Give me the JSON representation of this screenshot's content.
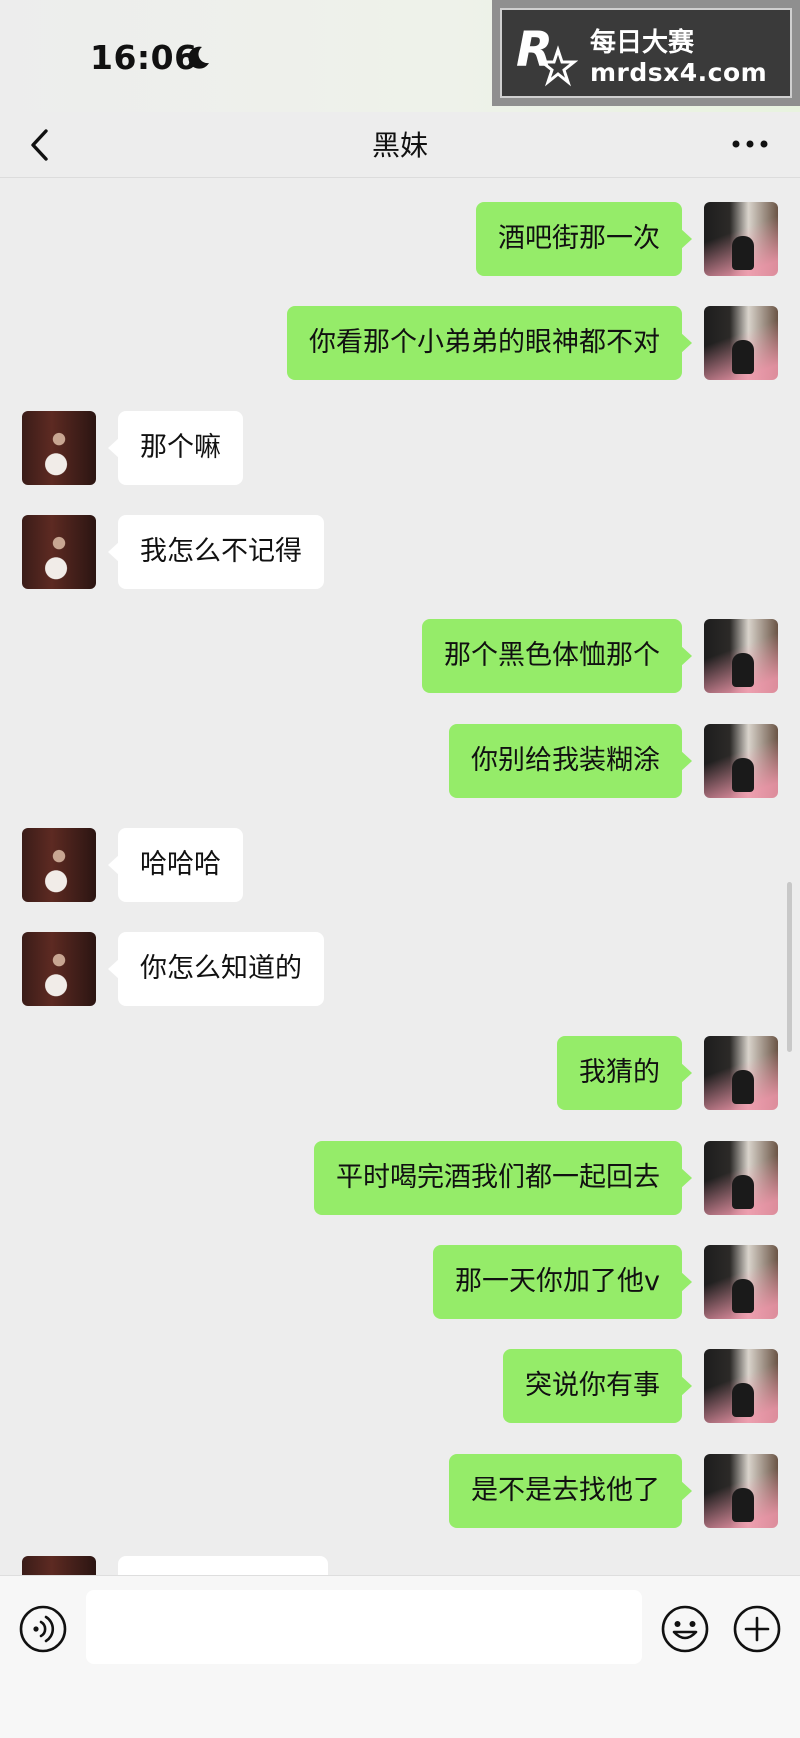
{
  "status_bar": {
    "time": "16:06",
    "moon_icon": "moon-icon"
  },
  "watermark": {
    "title": "每日大赛",
    "url": "mrdsx4.com",
    "logo_icon": "r-star-logo"
  },
  "nav": {
    "title": "黑妹",
    "back_icon": "chevron-left-icon",
    "more_icon": "more-dots-icon"
  },
  "colors": {
    "background": "#ededed",
    "sent_bubble": "#95ec69",
    "received_bubble": "#ffffff"
  },
  "messages": [
    {
      "side": "right",
      "text": "酒吧街那一次"
    },
    {
      "side": "right",
      "text": "你看那个小弟弟的眼神都不对"
    },
    {
      "side": "left",
      "text": "那个嘛"
    },
    {
      "side": "left",
      "text": "我怎么不记得"
    },
    {
      "side": "right",
      "text": "那个黑色体恤那个"
    },
    {
      "side": "right",
      "text": "你别给我装糊涂"
    },
    {
      "side": "left",
      "text": "哈哈哈"
    },
    {
      "side": "left",
      "text": "你怎么知道的"
    },
    {
      "side": "right",
      "text": "我猜的"
    },
    {
      "side": "right",
      "text": "平时喝完酒我们都一起回去"
    },
    {
      "side": "right",
      "text": "那一天你加了他v"
    },
    {
      "side": "right",
      "text": "突说你有事"
    },
    {
      "side": "right",
      "text": "是不是去找他了"
    }
  ],
  "input_bar": {
    "voice_icon": "voice-icon",
    "input_value": "",
    "emoji_icon": "emoji-icon",
    "plus_icon": "plus-icon"
  }
}
